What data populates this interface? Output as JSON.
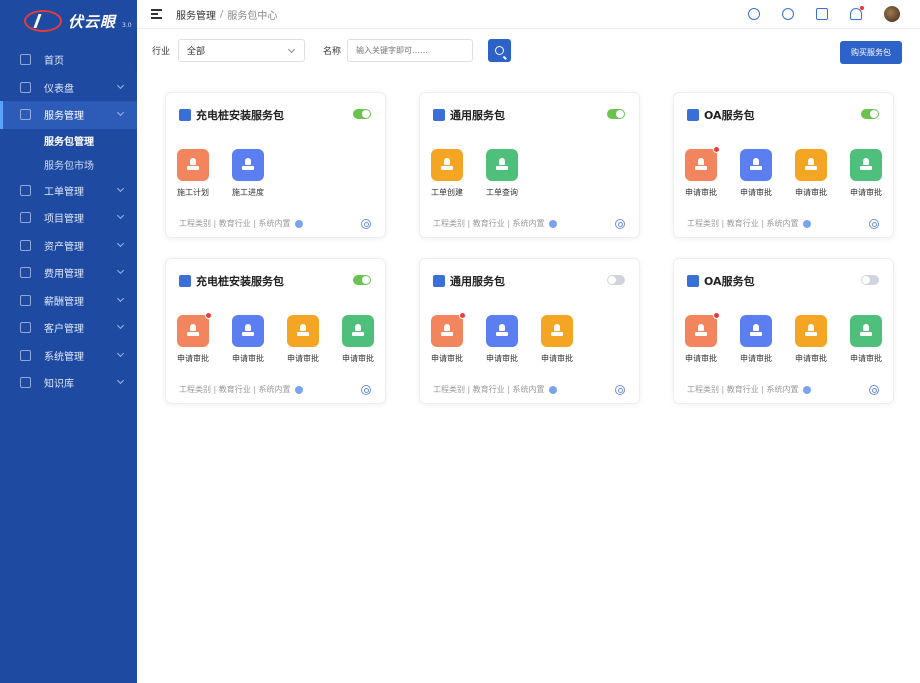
{
  "brand": {
    "name": "伏云眼",
    "sub": "3.0"
  },
  "sidebar": {
    "items": [
      {
        "label": "首页",
        "name": "sidebar-item-home",
        "icon": "home-icon",
        "chev": false
      },
      {
        "label": "仪表盘",
        "name": "sidebar-item-dashboard",
        "icon": "chart-icon",
        "chev": true
      },
      {
        "label": "服务管理",
        "name": "sidebar-item-service",
        "icon": "grid-icon",
        "chev": true,
        "active": true
      },
      {
        "label": "工单管理",
        "name": "sidebar-item-workorder",
        "icon": "clipboard-icon",
        "chev": true
      },
      {
        "label": "项目管理",
        "name": "sidebar-item-project",
        "icon": "folder-icon",
        "chev": true
      },
      {
        "label": "资产管理",
        "name": "sidebar-item-asset",
        "icon": "asset-icon",
        "chev": true
      },
      {
        "label": "费用管理",
        "name": "sidebar-item-cost",
        "icon": "receipt-icon",
        "chev": true
      },
      {
        "label": "薪酬管理",
        "name": "sidebar-item-salary",
        "icon": "wallet-icon",
        "chev": true
      },
      {
        "label": "客户管理",
        "name": "sidebar-item-customer",
        "icon": "users-icon",
        "chev": true
      },
      {
        "label": "系统管理",
        "name": "sidebar-item-system",
        "icon": "monitor-icon",
        "chev": true
      },
      {
        "label": "知识库",
        "name": "sidebar-item-knowledge",
        "icon": "book-icon",
        "chev": true
      }
    ],
    "sub_items": [
      {
        "label": "服务包管理"
      },
      {
        "label": "服务包市场"
      }
    ]
  },
  "header": {
    "crumb1": "服务管理",
    "sep": "/",
    "crumb2": "服务包中心"
  },
  "filter": {
    "industry_label": "行业",
    "industry_value": "全部",
    "name_label": "名称",
    "name_placeholder": "输入关键字即可……",
    "buy_label": "购买服务包"
  },
  "colors": {
    "orange": "#f2845e",
    "blue": "#5b7ff0",
    "yellow": "#f5a524",
    "green": "#4fbf7c"
  },
  "cards": [
    {
      "title": "充电桩安装服务包",
      "icon": "doc-play-icon",
      "icon_color": "#3a6fd8",
      "enabled": true,
      "apps": [
        {
          "label": "施工计划",
          "color": "orange",
          "dot": false
        },
        {
          "label": "施工进度",
          "color": "blue",
          "dot": false
        }
      ],
      "tags": "工程类别 | 教育行业 | 系统内置"
    },
    {
      "title": "通用服务包",
      "icon": "cube-icon",
      "icon_color": "#3a6fd8",
      "enabled": true,
      "apps": [
        {
          "label": "工单创建",
          "color": "yellow",
          "dot": false
        },
        {
          "label": "工单查询",
          "color": "green",
          "dot": false
        }
      ],
      "tags": "工程类别 | 教育行业 | 系统内置"
    },
    {
      "title": "OA服务包",
      "icon": "computer-icon",
      "icon_color": "#3a6fd8",
      "enabled": true,
      "apps": [
        {
          "label": "申请审批",
          "color": "orange",
          "dot": true
        },
        {
          "label": "申请审批",
          "color": "blue",
          "dot": false
        },
        {
          "label": "申请审批",
          "color": "yellow",
          "dot": false
        },
        {
          "label": "申请审批",
          "color": "green",
          "dot": false
        }
      ],
      "tags": "工程类别 | 教育行业 | 系统内置"
    },
    {
      "title": "充电桩安装服务包",
      "icon": "doc-play-icon",
      "icon_color": "#3a6fd8",
      "enabled": true,
      "apps": [
        {
          "label": "申请审批",
          "color": "orange",
          "dot": true
        },
        {
          "label": "申请审批",
          "color": "blue",
          "dot": false
        },
        {
          "label": "申请审批",
          "color": "yellow",
          "dot": false
        },
        {
          "label": "申请审批",
          "color": "green",
          "dot": false
        }
      ],
      "tags": "工程类别 | 教育行业 | 系统内置"
    },
    {
      "title": "通用服务包",
      "icon": "cube-icon",
      "icon_color": "#3a6fd8",
      "enabled": false,
      "apps": [
        {
          "label": "申请审批",
          "color": "orange",
          "dot": true
        },
        {
          "label": "申请审批",
          "color": "blue",
          "dot": false
        },
        {
          "label": "申请审批",
          "color": "yellow",
          "dot": false
        }
      ],
      "tags": "工程类别 | 教育行业 | 系统内置"
    },
    {
      "title": "OA服务包",
      "icon": "computer-icon",
      "icon_color": "#3a6fd8",
      "enabled": false,
      "apps": [
        {
          "label": "申请审批",
          "color": "orange",
          "dot": true
        },
        {
          "label": "申请审批",
          "color": "blue",
          "dot": false
        },
        {
          "label": "申请审批",
          "color": "yellow",
          "dot": false
        },
        {
          "label": "申请审批",
          "color": "green",
          "dot": false
        }
      ],
      "tags": "工程类别 | 教育行业 | 系统内置"
    }
  ]
}
